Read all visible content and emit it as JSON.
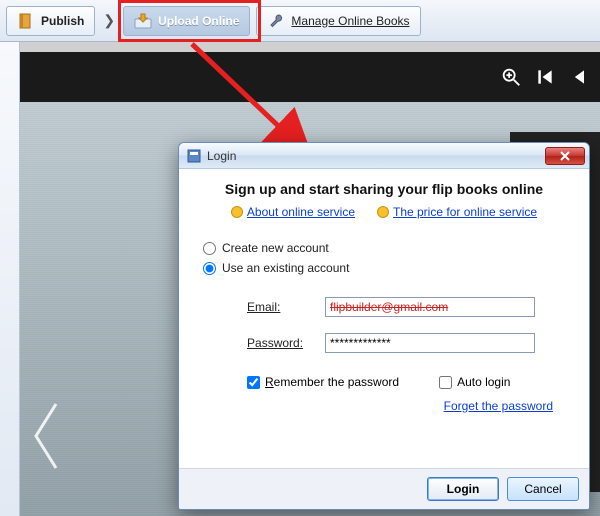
{
  "toolbar": {
    "publish_label": "Publish",
    "upload_label": "Upload Online",
    "manage_label": "Manage Online Books"
  },
  "dialog": {
    "title": "Login",
    "heading": "Sign up and start sharing your flip books online",
    "link_about": "About online service",
    "link_price": "The price for online service",
    "radio_create": "Create new account",
    "radio_existing": "Use an existing account",
    "email_label": "Email:",
    "email_value": "flipbuilder@gmail.com",
    "password_label": "Password:",
    "password_value": "*************",
    "remember_label": "Remember the password",
    "autologin_label": "Auto login",
    "forget_label": "Forget the password",
    "login_btn": "Login",
    "cancel_btn": "Cancel"
  }
}
